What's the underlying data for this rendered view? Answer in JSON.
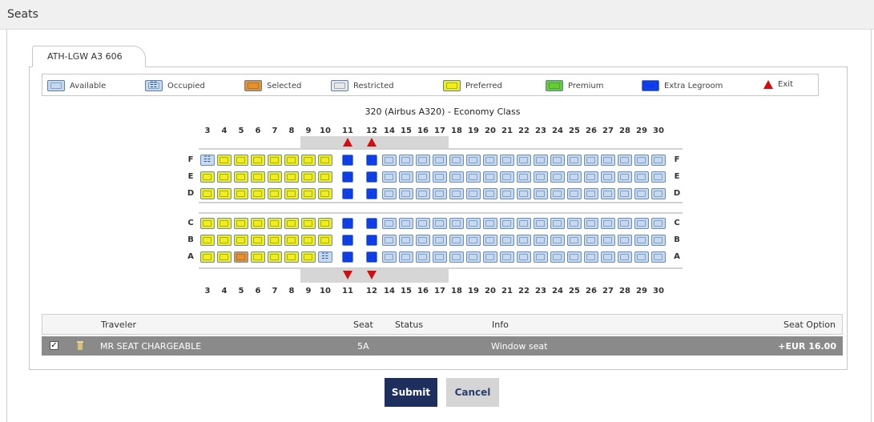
{
  "header": {
    "title": "Seats"
  },
  "tab": {
    "label": "ATH-LGW  A3 606"
  },
  "colors": {
    "available": "#c5d9f1",
    "occupied": "#c5d9f1",
    "selected": "#e8902a",
    "restricted": "#e8e8e8",
    "preferred": "#f2ee1a",
    "premium": "#66cc33",
    "extra_legroom": "#0a3bf0",
    "exit": "#d01010"
  },
  "legend": [
    {
      "key": "available",
      "label": "Available"
    },
    {
      "key": "occupied",
      "label": "Occupied"
    },
    {
      "key": "selected",
      "label": "Selected"
    },
    {
      "key": "restricted",
      "label": "Restricted"
    },
    {
      "key": "preferred",
      "label": "Preferred"
    },
    {
      "key": "premium",
      "label": "Premium"
    },
    {
      "key": "extra_legroom",
      "label": "Extra Legroom"
    },
    {
      "key": "exit",
      "label": "Exit"
    }
  ],
  "seatmap": {
    "title": "320 (Airbus A320) - Economy Class",
    "columns": [
      "3",
      "4",
      "5",
      "6",
      "7",
      "8",
      "9",
      "10",
      "11",
      "12",
      "14",
      "15",
      "16",
      "17",
      "18",
      "19",
      "20",
      "21",
      "22",
      "23",
      "24",
      "25",
      "26",
      "27",
      "28",
      "29",
      "30"
    ],
    "rows_upper": [
      "F",
      "E",
      "D"
    ],
    "rows_lower": [
      "C",
      "B",
      "A"
    ],
    "exit_rows": [
      "11",
      "12"
    ],
    "seats": {
      "F": [
        "occupied",
        "preferred",
        "preferred",
        "preferred",
        "preferred",
        "preferred",
        "preferred",
        "preferred",
        "extra_legroom",
        "extra_legroom",
        "available",
        "available",
        "available",
        "available",
        "available",
        "available",
        "available",
        "available",
        "available",
        "available",
        "available",
        "available",
        "available",
        "available",
        "available",
        "available",
        "available"
      ],
      "E": [
        "preferred",
        "preferred",
        "preferred",
        "preferred",
        "preferred",
        "preferred",
        "preferred",
        "preferred",
        "extra_legroom",
        "extra_legroom",
        "available",
        "available",
        "available",
        "available",
        "available",
        "available",
        "available",
        "available",
        "available",
        "available",
        "available",
        "available",
        "available",
        "available",
        "available",
        "available",
        "available"
      ],
      "D": [
        "preferred",
        "preferred",
        "preferred",
        "preferred",
        "preferred",
        "preferred",
        "preferred",
        "preferred",
        "extra_legroom",
        "extra_legroom",
        "available",
        "available",
        "available",
        "available",
        "available",
        "available",
        "available",
        "available",
        "available",
        "available",
        "available",
        "available",
        "available",
        "available",
        "available",
        "available",
        "available"
      ],
      "C": [
        "preferred",
        "preferred",
        "preferred",
        "preferred",
        "preferred",
        "preferred",
        "preferred",
        "preferred",
        "extra_legroom",
        "extra_legroom",
        "available",
        "available",
        "available",
        "available",
        "available",
        "available",
        "available",
        "available",
        "available",
        "available",
        "available",
        "available",
        "available",
        "available",
        "available",
        "available",
        "available"
      ],
      "B": [
        "preferred",
        "preferred",
        "preferred",
        "preferred",
        "preferred",
        "preferred",
        "preferred",
        "preferred",
        "extra_legroom",
        "extra_legroom",
        "available",
        "available",
        "available",
        "available",
        "available",
        "available",
        "available",
        "available",
        "available",
        "available",
        "available",
        "available",
        "available",
        "available",
        "available",
        "available",
        "available"
      ],
      "A": [
        "preferred",
        "preferred",
        "selected",
        "preferred",
        "preferred",
        "preferred",
        "preferred",
        "occupied",
        "extra_legroom",
        "extra_legroom",
        "available",
        "available",
        "available",
        "available",
        "available",
        "available",
        "available",
        "available",
        "available",
        "available",
        "available",
        "available",
        "available",
        "available",
        "available",
        "available",
        "available"
      ]
    }
  },
  "table": {
    "headers": {
      "traveler": "Traveler",
      "seat": "Seat",
      "status": "Status",
      "info": "Info",
      "seat_option": "Seat Option"
    },
    "row": {
      "checked": true,
      "traveler": "MR SEAT CHARGEABLE",
      "seat": "5A",
      "status": "",
      "info": "Window seat",
      "seat_option": "+EUR 16.00"
    }
  },
  "buttons": {
    "submit": "Submit",
    "cancel": "Cancel"
  }
}
